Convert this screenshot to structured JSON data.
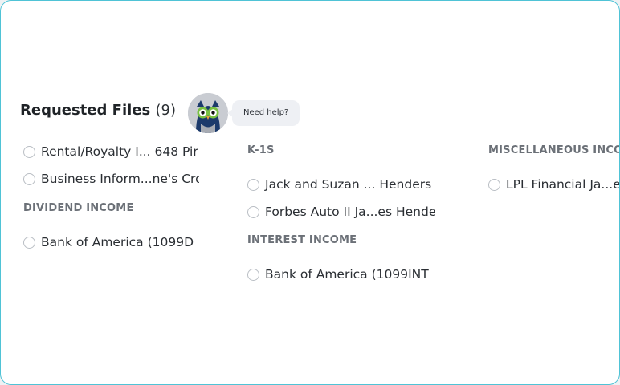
{
  "header": {
    "title": "Requested Files",
    "count": "(9)",
    "help_label": "Need help?",
    "avatar_icon": "owl-mascot-icon"
  },
  "column1": {
    "items": [
      {
        "label": "Rental/Royalty I... 648 Pir"
      },
      {
        "label": "Business Inform...ne's Cro"
      }
    ],
    "sections": [
      {
        "title": "DIVIDEND INCOME",
        "items": [
          {
            "label": "Bank of America (1099D"
          }
        ]
      }
    ]
  },
  "column2": {
    "sections": [
      {
        "title": "K-1S",
        "items": [
          {
            "label": "Jack and Suzan ... Henders"
          },
          {
            "label": "Forbes Auto II Ja...es Hende"
          }
        ]
      },
      {
        "title": "INTEREST INCOME",
        "items": [
          {
            "label": "Bank of America (1099INT"
          }
        ]
      }
    ]
  },
  "column3": {
    "sections": [
      {
        "title": "MISCELLANEOUS INCO",
        "items": [
          {
            "label": "LPL Financial Ja...e"
          }
        ]
      }
    ]
  },
  "colors": {
    "frame_border": "#4fc3d6",
    "section_heading": "#6b7077",
    "radio_border": "#b9bec4",
    "help_bubble": "#eef0f4"
  }
}
